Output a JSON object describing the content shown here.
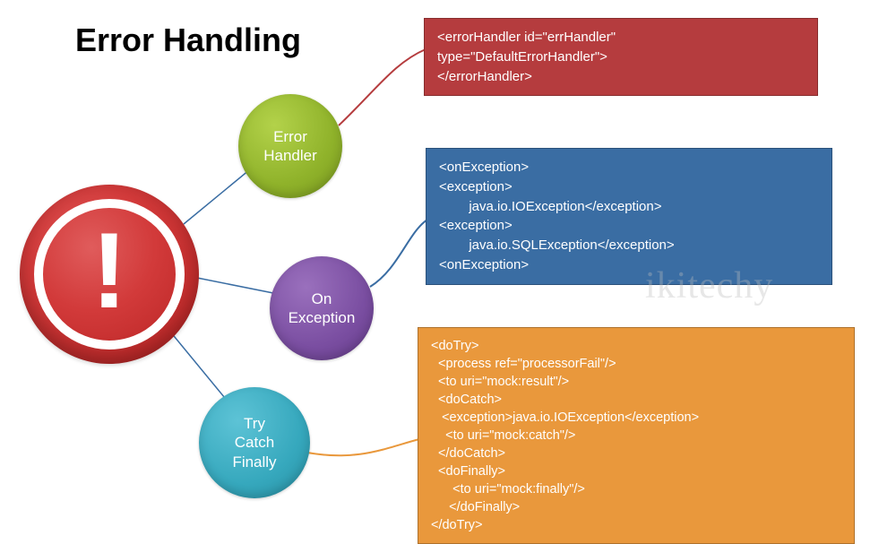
{
  "title": "Error Handling",
  "warning_symbol": "!",
  "watermark": "ikitechy",
  "nodes": {
    "error_handler": "Error\nHandler",
    "on_exception": "On\nException",
    "try_catch_finally": "Try\nCatch\nFinally"
  },
  "codeboxes": {
    "error_handler": "<errorHandler id=\"errHandler\"\ntype=\"DefaultErrorHandler\">\n</errorHandler>",
    "on_exception": "<onException>\n<exception>\n        java.io.IOException</exception>\n<exception>\n        java.io.SQLException</exception>\n<onException>",
    "do_try": "<doTry>\n  <process ref=\"processorFail\"/>\n  <to uri=\"mock:result\"/>\n  <doCatch>\n   <exception>java.io.IOException</exception>\n    <to uri=\"mock:catch\"/>\n  </doCatch>\n  <doFinally>\n      <to uri=\"mock:finally\"/>\n     </doFinally>\n</doTry>"
  }
}
